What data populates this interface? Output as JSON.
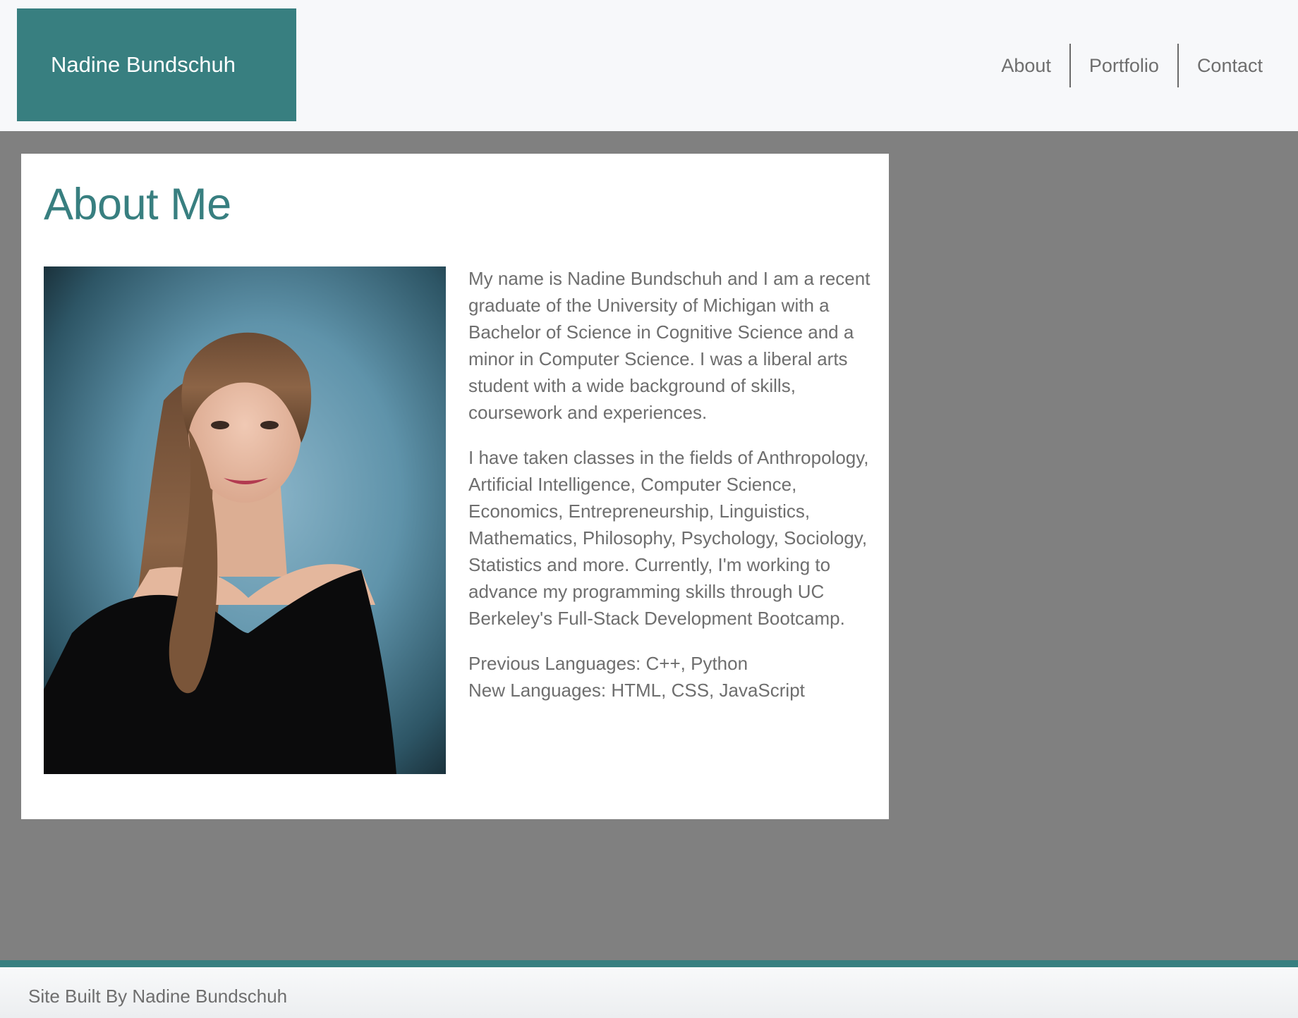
{
  "header": {
    "brand": "Nadine Bundschuh",
    "nav": [
      {
        "label": "About"
      },
      {
        "label": "Portfolio"
      },
      {
        "label": "Contact"
      }
    ]
  },
  "about": {
    "title": "About Me",
    "paragraphs": [
      "My name is Nadine Bundschuh and I am a recent graduate of the University of Michigan with a Bachelor of Science in Cognitive Science and a minor in Computer Science. I was a liberal arts student with a wide background of skills, coursework and experiences.",
      "I have taken classes in the fields of Anthropology, Artificial Intelligence, Computer Science, Economics, Entrepreneurship, Linguistics, Mathematics, Philosophy, Psychology, Sociology, Statistics and more. Currently, I'm working to advance my programming skills through UC Berkeley's Full-Stack Development Bootcamp."
    ],
    "languages": {
      "previous": "Previous Languages: C++, Python",
      "new": "New Languages: HTML, CSS, JavaScript"
    }
  },
  "footer": {
    "text": "Site Built By Nadine Bundschuh"
  },
  "colors": {
    "accent": "#387f80",
    "page_background": "#808080",
    "header_background": "#f7f8fa",
    "text": "#6e6e6e"
  }
}
